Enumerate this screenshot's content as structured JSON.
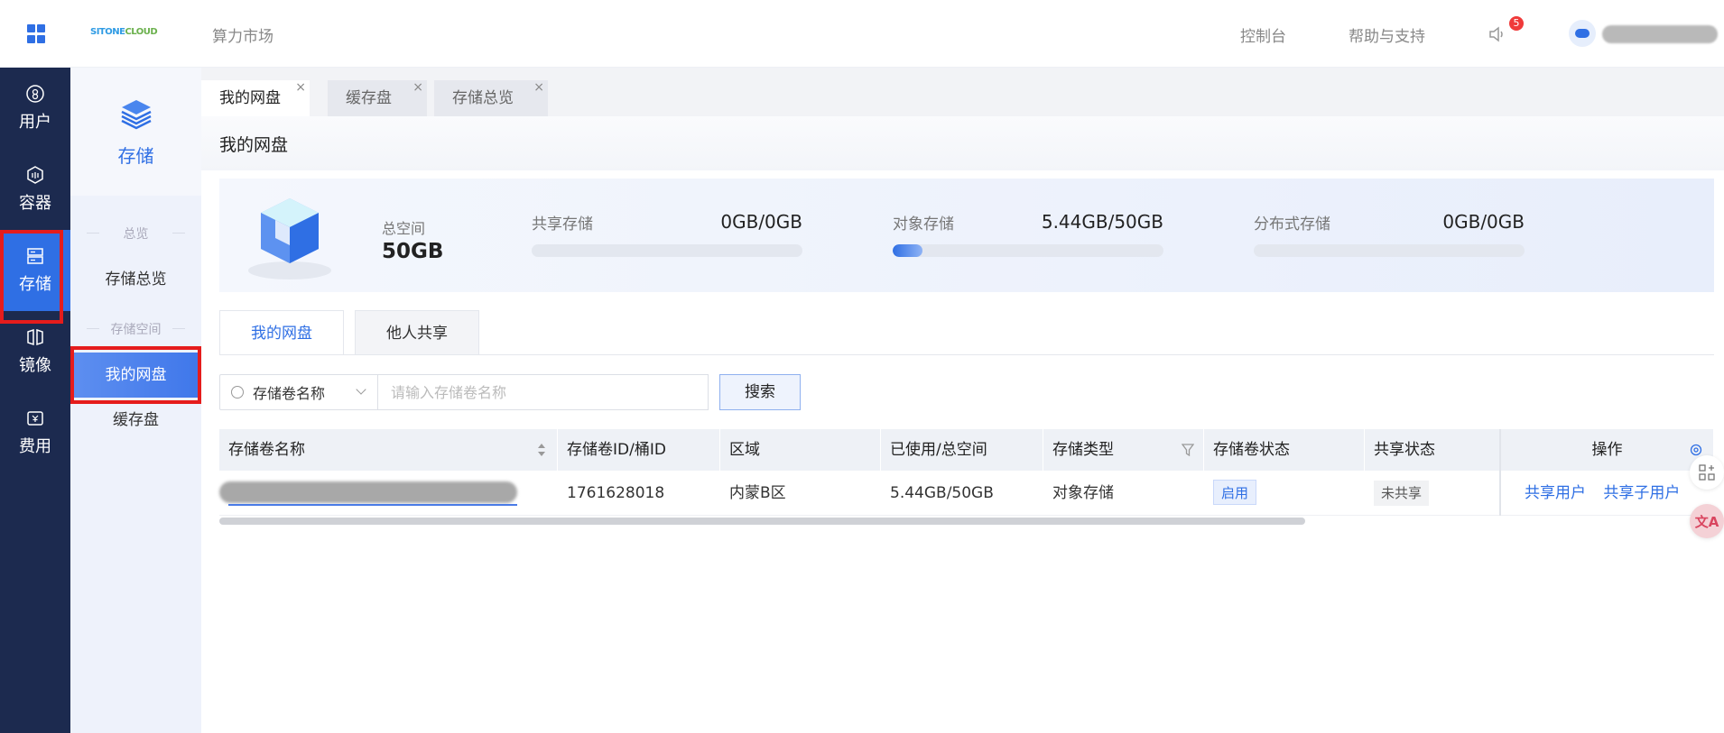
{
  "header": {
    "logo_text_a": "SITONE",
    "logo_text_b": "CLOUD",
    "market": "算力市场",
    "console": "控制台",
    "help": "帮助与支持",
    "notification_count": "5"
  },
  "leftnav": [
    {
      "label": "用户",
      "icon": "user-icon"
    },
    {
      "label": "容器",
      "icon": "container-icon"
    },
    {
      "label": "存储",
      "icon": "storage-icon",
      "active": true
    },
    {
      "label": "镜像",
      "icon": "image-icon"
    },
    {
      "label": "费用",
      "icon": "billing-icon"
    }
  ],
  "subnav": {
    "title": "存储",
    "group_overview": "总览",
    "item_overview": "存储总览",
    "group_space": "存储空间",
    "item_my_disk": "我的网盘",
    "item_cache": "缓存盘"
  },
  "page_tabs": [
    "我的网盘",
    "缓存盘",
    "存储总览"
  ],
  "page_title": "我的网盘",
  "stats": {
    "total_label": "总空间",
    "total_value": "50GB",
    "shared": {
      "label": "共享存储",
      "value": "0GB/0GB",
      "fill_fraction": 0
    },
    "object": {
      "label": "对象存储",
      "value": "5.44GB/50GB",
      "fill_fraction": 0.1088
    },
    "distributed": {
      "label": "分布式存储",
      "value": "0GB/0GB",
      "fill_fraction": 0
    }
  },
  "content_tabs": {
    "mine": "我的网盘",
    "shared": "他人共享"
  },
  "search": {
    "field": "存储卷名称",
    "placeholder": "请输入存储卷名称",
    "button": "搜索"
  },
  "table": {
    "columns": [
      "存储卷名称",
      "存储卷ID/桶ID",
      "区域",
      "已使用/总空间",
      "存储类型",
      "存储卷状态",
      "共享状态",
      "操作"
    ],
    "rows": [
      {
        "id": "1761628018",
        "region": "内蒙B区",
        "usage": "5.44GB/50GB",
        "type": "对象存储",
        "status": "启用",
        "share_status": "未共享",
        "actions": [
          "共享用户",
          "共享子用户"
        ]
      }
    ]
  },
  "colors": {
    "accent": "#2f6fe4",
    "nav_bg": "#1c2a4f",
    "highlight": "#e51c1c"
  }
}
